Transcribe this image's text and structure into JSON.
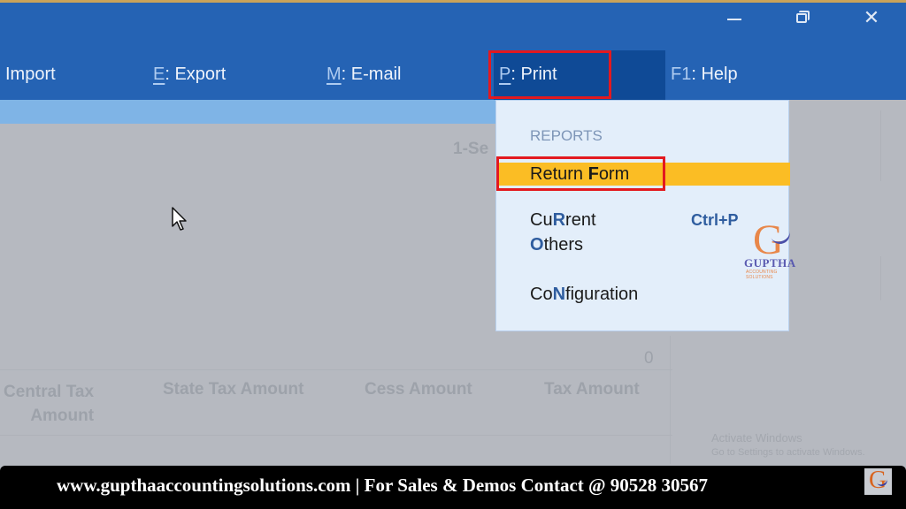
{
  "window": {
    "controls": {
      "minimize": "minimize-icon",
      "restore": "restore-icon",
      "close": "close-icon",
      "close_glyph": "✕"
    }
  },
  "menubar": {
    "items": [
      {
        "key": "",
        "sep": "",
        "label": "Import"
      },
      {
        "key": "E",
        "sep": ":",
        "label": "Export"
      },
      {
        "key": "M",
        "sep": ":",
        "label": "E-mail"
      },
      {
        "key": "P",
        "sep": ":",
        "label": "Print",
        "active": true
      },
      {
        "key": "F1",
        "sep": ":",
        "label": "Help"
      }
    ]
  },
  "background": {
    "period_fragment": "1-Se",
    "zero_value": "0",
    "columns": [
      "Central Tax",
      "Amount",
      "State Tax Amount",
      "Cess Amount",
      "Tax Amount"
    ]
  },
  "print_menu": {
    "heading": "REPORTS",
    "items": [
      {
        "pre": "Return ",
        "hk": "F",
        "post": "orm",
        "selected": true
      },
      {
        "pre": "Cu",
        "hk": "R",
        "post": "rent",
        "shortcut": "Ctrl+P"
      },
      {
        "pre": "",
        "hk": "O",
        "post": "thers"
      },
      {
        "pre": "Co",
        "hk": "N",
        "post": "figuration"
      }
    ]
  },
  "watermark": {
    "logo_letter": "G",
    "logo_name": "GUPTHA",
    "logo_tagline": "ACCOUNTING SOLUTIONS"
  },
  "os_notice": {
    "title": "Activate Windows",
    "subtitle": "Go to Settings to activate Windows."
  },
  "footer": {
    "text": "www.gupthaaccountingsolutions.com | For Sales & Demos Contact @ 90528 30567",
    "logo_letter": "G"
  },
  "colors": {
    "titlebar": "#2563b4",
    "active_menu": "#0f4a96",
    "selection": "#fbbd24",
    "highlight_box": "#e3191f",
    "dropdown_bg": "#e3eefa"
  }
}
